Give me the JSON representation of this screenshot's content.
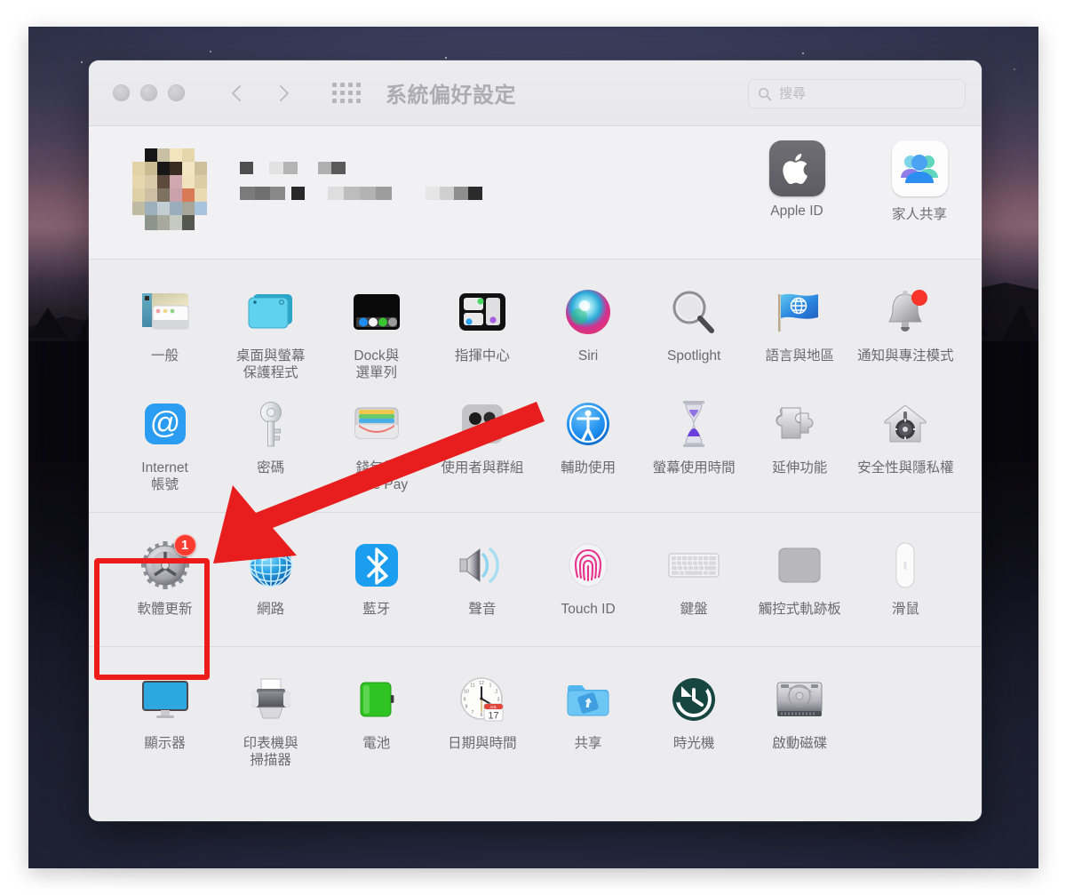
{
  "window": {
    "title": "系統偏好設定",
    "traffic_lights": [
      "close",
      "minimize",
      "zoom"
    ],
    "back_label": "上一頁",
    "forward_label": "下一頁",
    "grid_label": "顯示全部"
  },
  "search": {
    "placeholder": "搜尋",
    "value": ""
  },
  "account": {
    "name_redacted": true,
    "avatar_redacted": true,
    "tiles": [
      {
        "label": "Apple ID",
        "icon": "apple-logo-icon"
      },
      {
        "label": "家人共享",
        "icon": "family-sharing-icon"
      }
    ]
  },
  "sections": [
    {
      "name": "personal",
      "panes": [
        {
          "label": "一般",
          "icon": "general-icon"
        },
        {
          "label": "桌面與螢幕\n保護程式",
          "icon": "desktop-screensaver-icon"
        },
        {
          "label": "Dock與\n選單列",
          "icon": "dock-menubar-icon"
        },
        {
          "label": "指揮中心",
          "icon": "control-center-icon"
        },
        {
          "label": "Siri",
          "icon": "siri-icon"
        },
        {
          "label": "Spotlight",
          "icon": "spotlight-icon"
        },
        {
          "label": "語言與地區",
          "icon": "language-region-icon"
        },
        {
          "label": "通知與專注模式",
          "icon": "notifications-focus-icon"
        },
        {
          "label": "Internet\n帳號",
          "icon": "internet-accounts-icon"
        },
        {
          "label": "密碼",
          "icon": "passwords-icon"
        },
        {
          "label": "錢包與\nApple Pay",
          "icon": "wallet-applepay-icon"
        },
        {
          "label": "使用者與群組",
          "icon": "users-groups-icon"
        },
        {
          "label": "輔助使用",
          "icon": "accessibility-icon"
        },
        {
          "label": "螢幕使用時間",
          "icon": "screen-time-icon"
        },
        {
          "label": "延伸功能",
          "icon": "extensions-icon"
        },
        {
          "label": "安全性與隱私權",
          "icon": "security-privacy-icon"
        }
      ]
    },
    {
      "name": "hardware",
      "panes": [
        {
          "label": "軟體更新",
          "icon": "software-update-icon",
          "badge": "1",
          "highlighted": true
        },
        {
          "label": "網路",
          "icon": "network-icon"
        },
        {
          "label": "藍牙",
          "icon": "bluetooth-icon"
        },
        {
          "label": "聲音",
          "icon": "sound-icon"
        },
        {
          "label": "Touch ID",
          "icon": "touch-id-icon"
        },
        {
          "label": "鍵盤",
          "icon": "keyboard-icon"
        },
        {
          "label": "觸控式軌跡板",
          "icon": "trackpad-icon"
        },
        {
          "label": "滑鼠",
          "icon": "mouse-icon"
        }
      ]
    },
    {
      "name": "system",
      "panes": [
        {
          "label": "顯示器",
          "icon": "displays-icon"
        },
        {
          "label": "印表機與\n掃描器",
          "icon": "printers-scanners-icon"
        },
        {
          "label": "電池",
          "icon": "battery-icon"
        },
        {
          "label": "日期與時間",
          "icon": "date-time-icon",
          "calendar_month": "JUL",
          "calendar_day": "17"
        },
        {
          "label": "共享",
          "icon": "sharing-icon"
        },
        {
          "label": "時光機",
          "icon": "time-machine-icon"
        },
        {
          "label": "啟動磁碟",
          "icon": "startup-disk-icon"
        }
      ]
    }
  ],
  "annotations": {
    "arrow_color": "#e81d1d",
    "highlight_color": "#ee1b1b",
    "badge_color": "#fa3b30"
  }
}
